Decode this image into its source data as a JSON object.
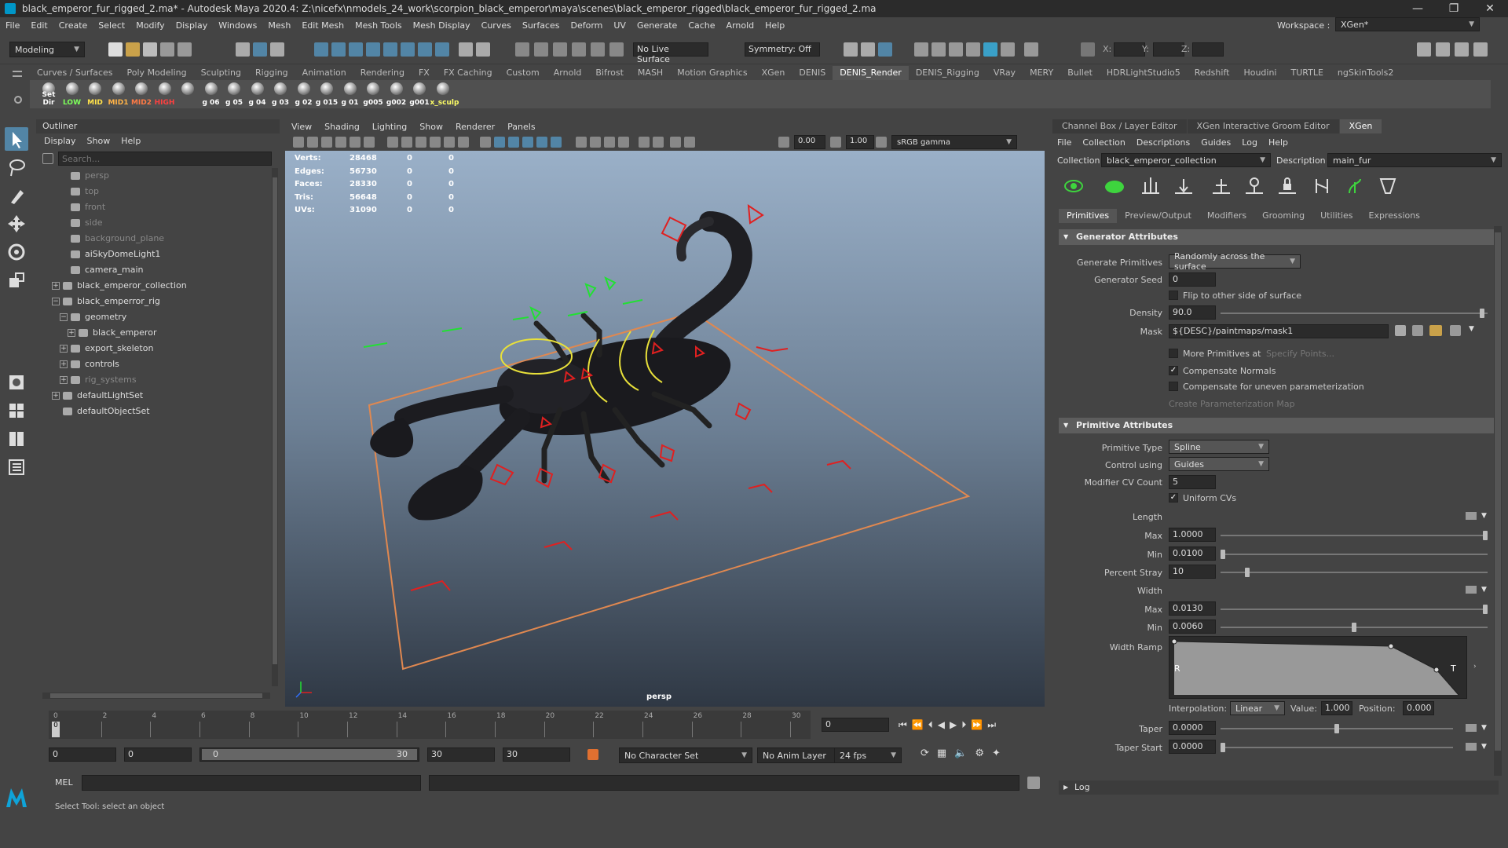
{
  "window": {
    "title": "black_emperor_fur_rigged_2.ma* - Autodesk Maya 2020.4: Z:\\nicefx\\nmodels_24_work\\scorpion_black_emperor\\maya\\scenes\\black_emperor_rigged\\black_emperor_fur_rigged_2.ma",
    "workspace_label": "Workspace :",
    "workspace_value": "XGen*"
  },
  "menubar": [
    "File",
    "Edit",
    "Create",
    "Select",
    "Modify",
    "Display",
    "Windows",
    "Mesh",
    "Edit Mesh",
    "Mesh Tools",
    "Mesh Display",
    "Curves",
    "Surfaces",
    "Deform",
    "UV",
    "Generate",
    "Cache",
    "Arnold",
    "Help"
  ],
  "statusline": {
    "mode": "Modeling",
    "live_surface": "No Live Surface",
    "symmetry": "Symmetry: Off",
    "x_label": "X:",
    "y_label": "Y:",
    "z_label": "Z:"
  },
  "shelf": {
    "tabs": [
      "Curves / Surfaces",
      "Poly Modeling",
      "Sculpting",
      "Rigging",
      "Animation",
      "Rendering",
      "FX",
      "FX Caching",
      "Custom",
      "Arnold",
      "Bifrost",
      "MASH",
      "Motion Graphics",
      "XGen",
      "DENIS",
      "DENIS_Render",
      "DENIS_Rigging",
      "VRay",
      "MERY",
      "Bullet",
      "HDRLightStudio5",
      "Redshift",
      "Houdini",
      "TURTLE",
      "ngSkinTools2"
    ],
    "active_tab": "DENIS_Render",
    "buttons": [
      {
        "label": "Set Dir",
        "color": "#ffffff"
      },
      {
        "label": "LOW",
        "color": "#7dff5a"
      },
      {
        "label": "MID",
        "color": "#ffe14a"
      },
      {
        "label": "MID1",
        "color": "#ffb347"
      },
      {
        "label": "MID2",
        "color": "#ff7a45"
      },
      {
        "label": "HIGH",
        "color": "#ff4040"
      },
      {
        "label": "",
        "color": "#ffffff"
      },
      {
        "label": "g 06",
        "color": "#ffffff"
      },
      {
        "label": "g 05",
        "color": "#ffffff"
      },
      {
        "label": "g 04",
        "color": "#ffffff"
      },
      {
        "label": "g 03",
        "color": "#ffffff"
      },
      {
        "label": "g 02",
        "color": "#ffffff"
      },
      {
        "label": "g 015",
        "color": "#ffffff"
      },
      {
        "label": "g 01",
        "color": "#ffffff"
      },
      {
        "label": "g005",
        "color": "#ffffff"
      },
      {
        "label": "g002",
        "color": "#ffffff"
      },
      {
        "label": "g001",
        "color": "#ffffff"
      },
      {
        "label": "x_sculp",
        "color": "#ffff66"
      }
    ]
  },
  "outliner": {
    "title": "Outliner",
    "menu": [
      "Display",
      "Show",
      "Help"
    ],
    "search_placeholder": "Search...",
    "items": [
      {
        "label": "persp",
        "indent": 2,
        "dim": true,
        "expander": ""
      },
      {
        "label": "top",
        "indent": 2,
        "dim": true,
        "expander": ""
      },
      {
        "label": "front",
        "indent": 2,
        "dim": true,
        "expander": ""
      },
      {
        "label": "side",
        "indent": 2,
        "dim": true,
        "expander": ""
      },
      {
        "label": "background_plane",
        "indent": 2,
        "dim": true,
        "expander": ""
      },
      {
        "label": "aiSkyDomeLight1",
        "indent": 2,
        "dim": false,
        "expander": ""
      },
      {
        "label": "camera_main",
        "indent": 2,
        "dim": false,
        "expander": ""
      },
      {
        "label": "black_emperor_collection",
        "indent": 1,
        "dim": false,
        "expander": "+"
      },
      {
        "label": "black_emperror_rig",
        "indent": 1,
        "dim": false,
        "expander": "-"
      },
      {
        "label": "geometry",
        "indent": 2,
        "dim": false,
        "expander": "-"
      },
      {
        "label": "black_emperor",
        "indent": 3,
        "dim": false,
        "expander": "+"
      },
      {
        "label": "export_skeleton",
        "indent": 2,
        "dim": false,
        "expander": "+"
      },
      {
        "label": "controls",
        "indent": 2,
        "dim": false,
        "expander": "+"
      },
      {
        "label": "rig_systems",
        "indent": 2,
        "dim": true,
        "expander": "+"
      },
      {
        "label": "defaultLightSet",
        "indent": 1,
        "dim": false,
        "expander": "+"
      },
      {
        "label": "defaultObjectSet",
        "indent": 1,
        "dim": false,
        "expander": ""
      }
    ]
  },
  "viewport": {
    "menu": [
      "View",
      "Shading",
      "Lighting",
      "Show",
      "Renderer",
      "Panels"
    ],
    "exposure": "0.00",
    "gamma": "1.00",
    "color_space": "sRGB gamma",
    "camera_label": "persp",
    "hud": [
      {
        "label": "Verts:",
        "v1": "28468",
        "v2": "0",
        "v3": "0"
      },
      {
        "label": "Edges:",
        "v1": "56730",
        "v2": "0",
        "v3": "0"
      },
      {
        "label": "Faces:",
        "v1": "28330",
        "v2": "0",
        "v3": "0"
      },
      {
        "label": "Tris:",
        "v1": "56648",
        "v2": "0",
        "v3": "0"
      },
      {
        "label": "UVs:",
        "v1": "31090",
        "v2": "0",
        "v3": "0"
      }
    ]
  },
  "rightpanel": {
    "tabs": [
      "Channel Box / Layer Editor",
      "XGen Interactive Groom Editor",
      "XGen"
    ],
    "active_tab": "XGen",
    "menu": [
      "File",
      "Collection",
      "Descriptions",
      "Guides",
      "Log",
      "Help"
    ],
    "collection_label": "Collection",
    "collection_value": "black_emperor_collection",
    "description_label": "Description",
    "description_value": "main_fur",
    "subtabs": [
      "Primitives",
      "Preview/Output",
      "Modifiers",
      "Grooming",
      "Utilities",
      "Expressions"
    ],
    "active_subtab": "Primitives",
    "generator": {
      "title": "Generator Attributes",
      "generate_primitives_label": "Generate Primitives",
      "generate_primitives_value": "Randomly across the surface",
      "seed_label": "Generator Seed",
      "seed_value": "0",
      "flip_label": "Flip to other side of surface",
      "density_label": "Density",
      "density_value": "90.0",
      "density_level": 0.98,
      "mask_label": "Mask",
      "mask_value": "${DESC}/paintmaps/mask1",
      "more_prims_label": "More Primitives at",
      "specify_points": "Specify Points...",
      "compensate_normals": "Compensate Normals",
      "compensate_param": "Compensate for uneven parameterization",
      "create_param_map": "Create Parameterization Map"
    },
    "primitive": {
      "title": "Primitive Attributes",
      "type_label": "Primitive Type",
      "type_value": "Spline",
      "control_label": "Control using",
      "control_value": "Guides",
      "cv_count_label": "Modifier CV Count",
      "cv_count_value": "5",
      "uniform_cvs": "Uniform CVs",
      "length_label": "Length",
      "max_label": "Max",
      "min_label": "Min",
      "length_max": "1.0000",
      "length_max_level": 1.0,
      "length_min": "0.0100",
      "length_min_level": 0.01,
      "percent_stray_label": "Percent Stray",
      "percent_stray_value": "10",
      "percent_stray_level": 0.1,
      "width_label": "Width",
      "width_max": "0.0130",
      "width_max_level": 1.0,
      "width_min": "0.0060",
      "width_min_level": 0.5,
      "width_ramp_label": "Width Ramp",
      "ramp_r": "R",
      "ramp_t": "T",
      "interpolation_label": "Interpolation:",
      "interpolation_value": "Linear",
      "value_label": "Value:",
      "value_value": "1.000",
      "position_label": "Position:",
      "position_value": "0.000",
      "taper_label": "Taper",
      "taper_value": "0.0000",
      "taper_level": 0.5,
      "taper_start_label": "Taper Start",
      "taper_start_value": "0.0000",
      "taper_start_level": 0.0
    },
    "log_label": "Log"
  },
  "timeslider": {
    "ticks": [
      "0",
      "2",
      "4",
      "6",
      "8",
      "10",
      "12",
      "14",
      "16",
      "18",
      "20",
      "22",
      "24",
      "26",
      "28",
      "30"
    ],
    "current_frame": "0",
    "current_field": "0"
  },
  "rangeslider": {
    "start": "0",
    "start_inner": "0",
    "range_start": "0",
    "range_end": "30",
    "end_inner": "30",
    "end": "30",
    "character_set": "No Character Set",
    "anim_layer": "No Anim Layer",
    "fps": "24 fps"
  },
  "cmdline": {
    "lang": "MEL"
  },
  "helpline": "Select Tool: select an object"
}
